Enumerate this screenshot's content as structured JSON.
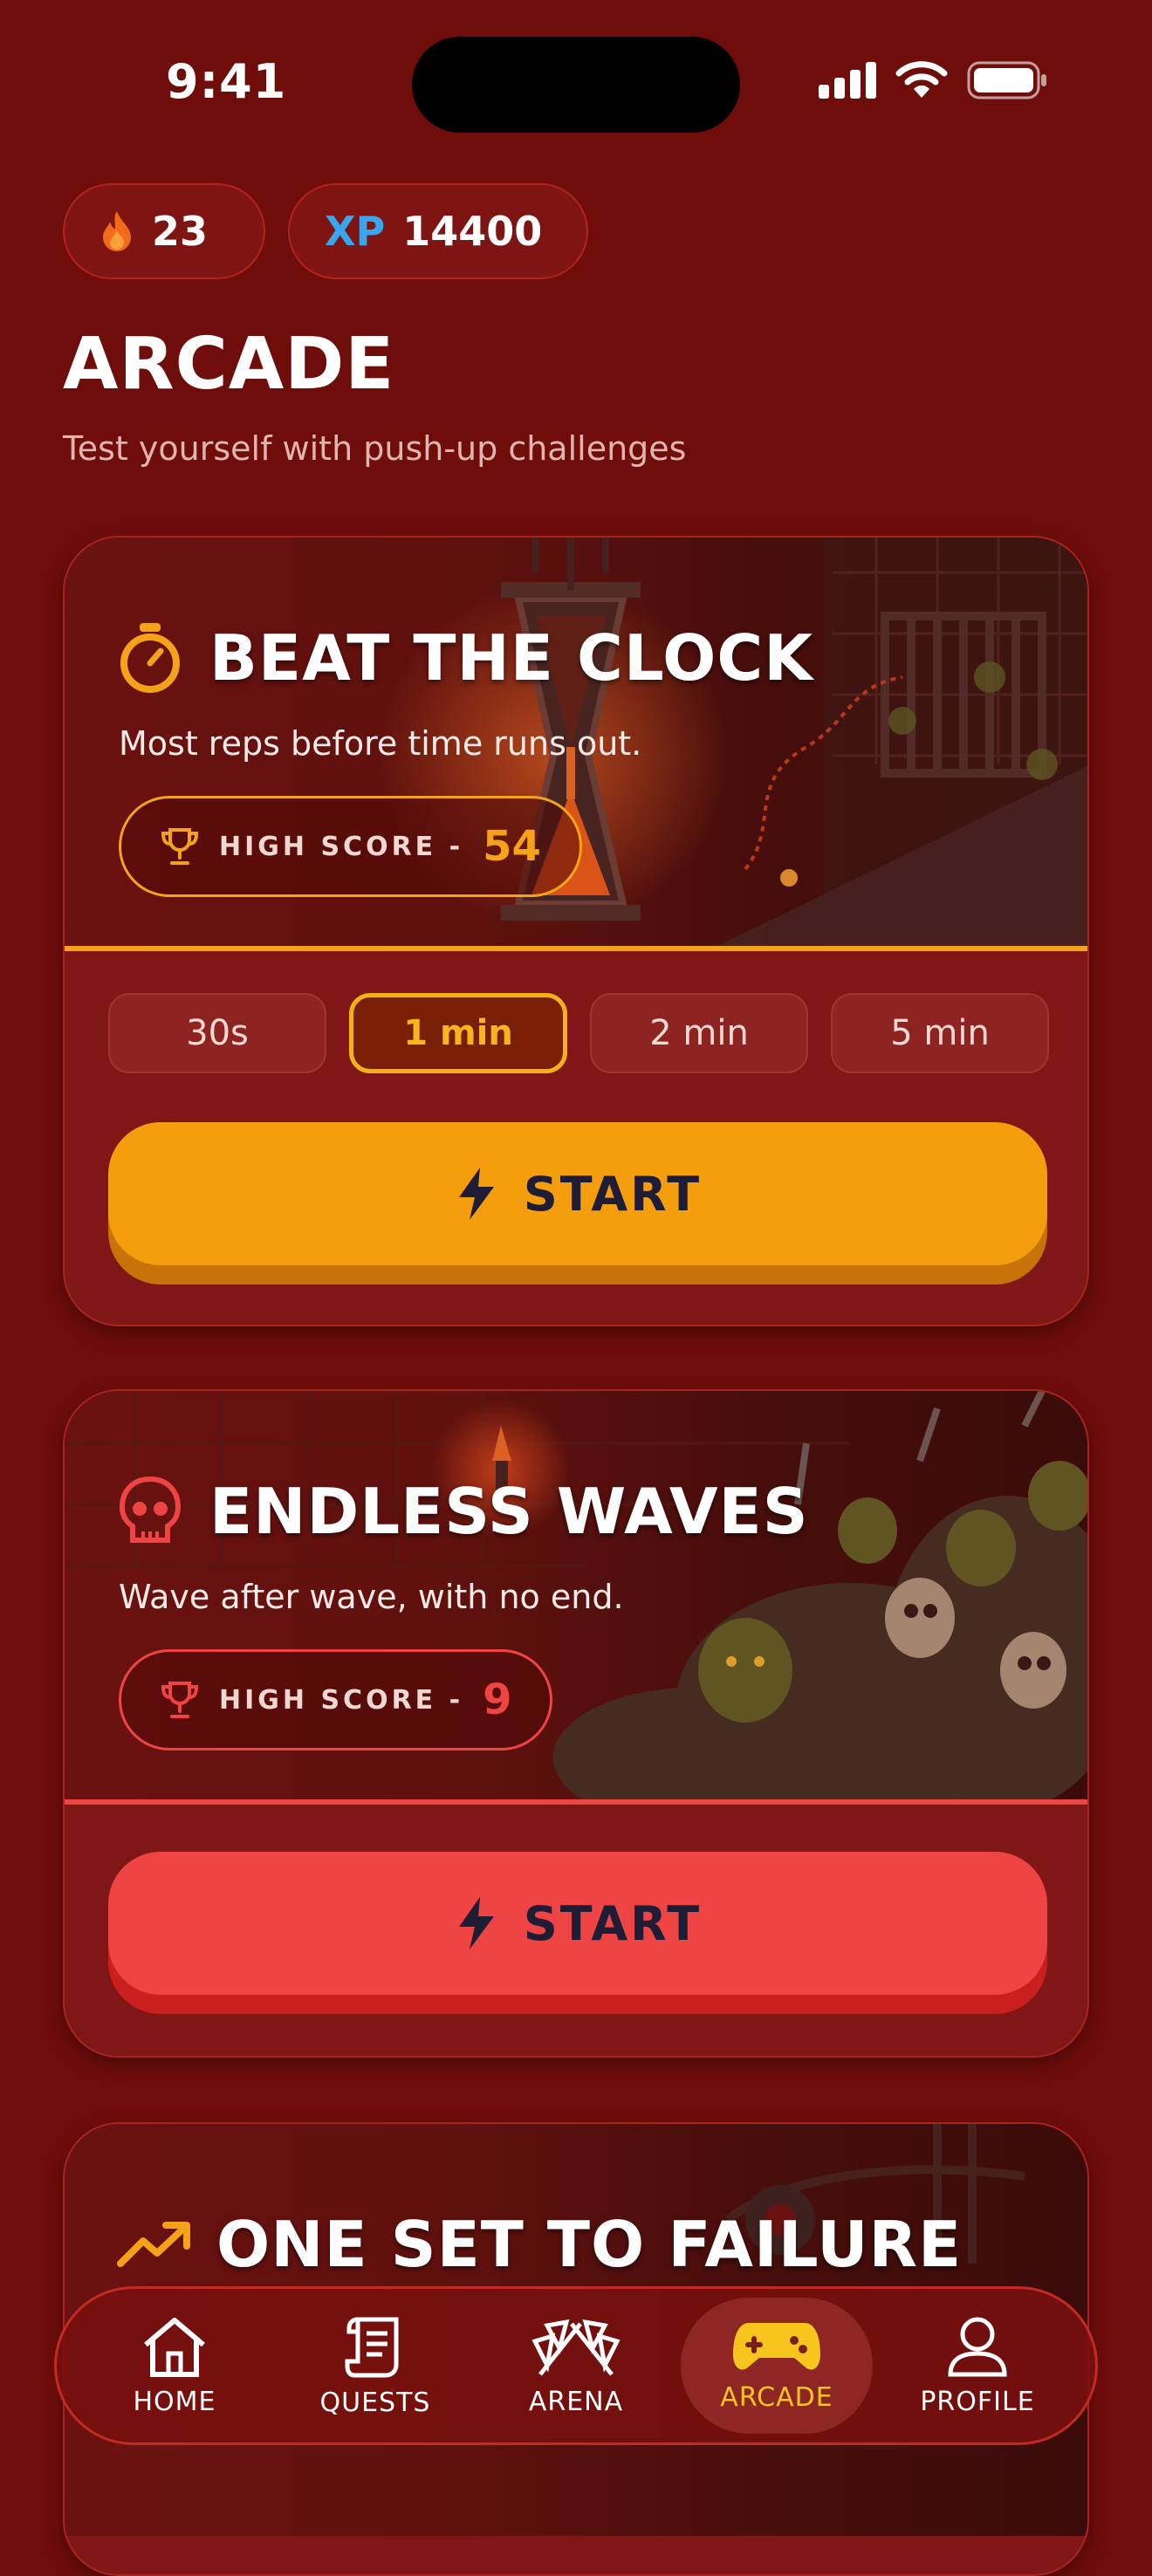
{
  "status_bar": {
    "time": "9:41"
  },
  "header": {
    "streak": "23",
    "xp_label": "XP",
    "xp_value": "14400",
    "title": "ARCADE",
    "subtitle": "Test yourself with push-up challenges"
  },
  "cards": [
    {
      "name": "BEAT THE CLOCK",
      "icon": "stopwatch-icon",
      "description": "Most reps before time runs out.",
      "high_score_label": "HIGH SCORE -",
      "high_score": "54",
      "accent": "#f4a21a",
      "durations": [
        "30s",
        "1 min",
        "2 min",
        "5 min"
      ],
      "selected_duration": "1 min",
      "start_label": "START"
    },
    {
      "name": "ENDLESS WAVES",
      "icon": "skull-icon",
      "description": "Wave after wave, with no end.",
      "high_score_label": "HIGH SCORE -",
      "high_score": "9",
      "accent": "#ef4444",
      "start_label": "START"
    },
    {
      "name": "ONE SET TO FAILURE",
      "icon": "trending-up-icon",
      "accent": "#f4a21a"
    }
  ],
  "nav": {
    "items": [
      {
        "label": "HOME",
        "icon": "home-icon"
      },
      {
        "label": "QUESTS",
        "icon": "scroll-icon"
      },
      {
        "label": "ARENA",
        "icon": "crossed-flags-icon"
      },
      {
        "label": "ARCADE",
        "icon": "gamepad-icon",
        "active": true
      },
      {
        "label": "PROFILE",
        "icon": "user-icon"
      }
    ]
  }
}
